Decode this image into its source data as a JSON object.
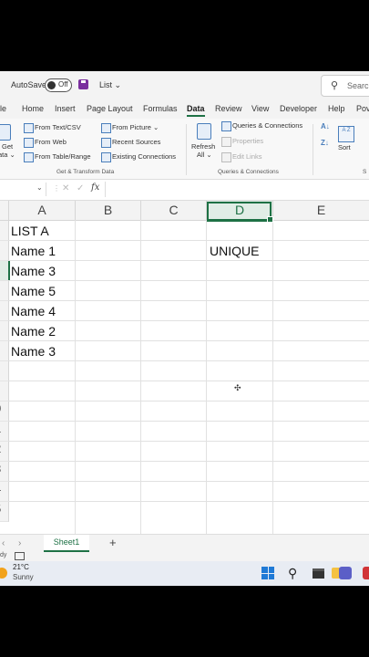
{
  "titlebar": {
    "autosave_label": "AutoSave",
    "toggle_state": "Off",
    "file_name": "List ⌄",
    "search_placeholder": "Searc"
  },
  "tabs": [
    "ile",
    "Home",
    "Insert",
    "Page Layout",
    "Formulas",
    "Data",
    "Review",
    "View",
    "Developer",
    "Help",
    "Pov"
  ],
  "active_tab": "Data",
  "ribbon": {
    "get_data": "Get",
    "get_data2": "ata ⌄",
    "from_text_csv": "From Text/CSV",
    "from_web": "From Web",
    "from_table_range": "From Table/Range",
    "from_picture": "From Picture ⌄",
    "recent_sources": "Recent Sources",
    "existing_connections": "Existing Connections",
    "group_get_transform": "Get & Transform Data",
    "refresh": "Refresh",
    "refresh_all": "All ⌄",
    "queries_connections": "Queries & Connections",
    "properties": "Properties",
    "edit_links": "Edit Links",
    "group_queries": "Queries & Connections",
    "sort": "Sort",
    "group_sort": "S"
  },
  "formula_bar": {
    "fx": "fx",
    "cancel": "✕",
    "enter": "✓",
    "value": ""
  },
  "columns": [
    "A",
    "B",
    "C",
    "D",
    "E"
  ],
  "selected_column": "D",
  "cells": {
    "A1": "LIST A",
    "A2": "Name 1",
    "A3": "Name 3",
    "A4": "Name 5",
    "A5": "Name 4",
    "A6": "Name 2",
    "A7": "Name 3",
    "D2": "UNIQUE"
  },
  "row_numbers": [
    "0",
    "1",
    "2",
    "3",
    "4",
    "5"
  ],
  "sheet_tabs": {
    "active": "Sheet1",
    "add": "+"
  },
  "statusbar": {
    "ready": "dy"
  },
  "taskbar": {
    "temperature": "21°C",
    "condition": "Sunny"
  },
  "colors": {
    "excel_green": "#1e7145",
    "taskbar": "#e8ecf3"
  }
}
